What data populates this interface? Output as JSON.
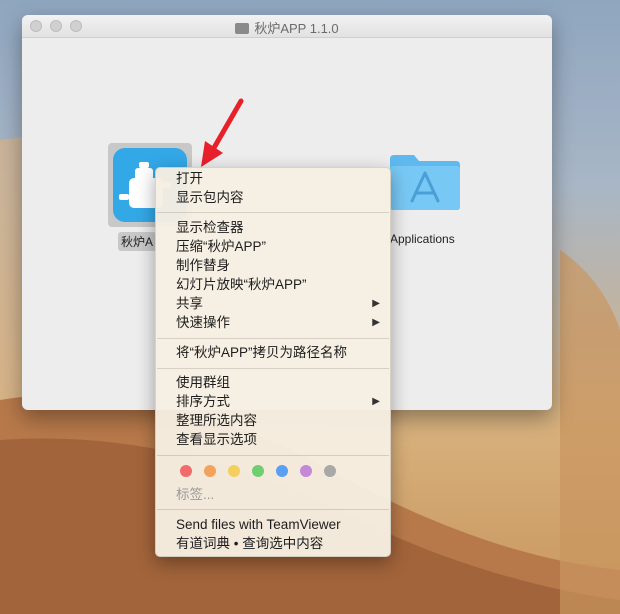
{
  "window": {
    "title": "秋炉APP 1.1.0",
    "app_item_label": "秋炉A",
    "applications_label": "Applications"
  },
  "context_menu": {
    "open": "打开",
    "show_package_contents": "显示包内容",
    "show_inspector": "显示检查器",
    "compress": "压缩“秋炉APP”",
    "make_alias": "制作替身",
    "slideshow": "幻灯片放映“秋炉APP”",
    "share": "共享",
    "quick_actions": "快速操作",
    "copy_path": "将“秋炉APP”拷贝为路径名称",
    "use_groups": "使用群组",
    "sort_by": "排序方式",
    "clean_up": "整理所选内容",
    "view_options": "查看显示选项",
    "tags": "标签...",
    "teamviewer": "Send files with TeamViewer",
    "youdao": "有道词典 • 查询选中内容",
    "submenu_arrow": "▶"
  },
  "tag_colors": [
    "#f26b6b",
    "#f2a25a",
    "#f4cf5c",
    "#6fce6f",
    "#5aa0f2",
    "#c488d9",
    "#a8a8a8"
  ]
}
